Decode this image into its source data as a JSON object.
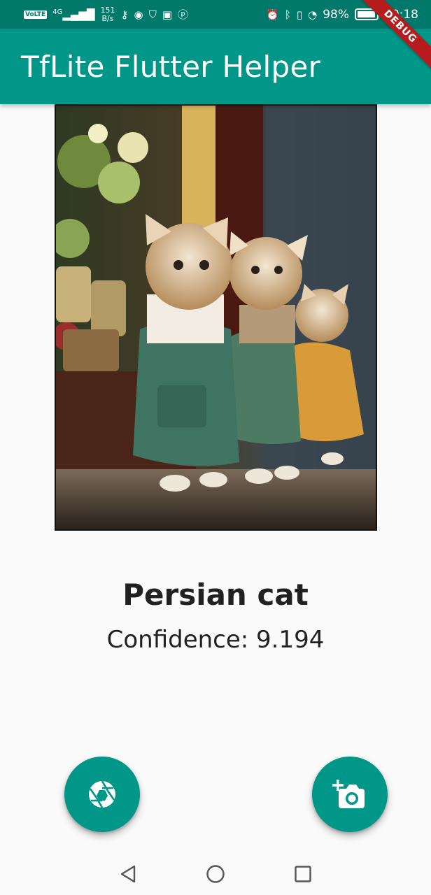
{
  "status_bar": {
    "volte": "VoLTE",
    "network": "4G",
    "speed_value": "151",
    "speed_unit": "B/s",
    "battery_percent": "98%",
    "battery_level": 0.98,
    "time": "20:18"
  },
  "app_bar": {
    "title": "TfLite Flutter Helper"
  },
  "debug_banner": {
    "label": "DEBUG"
  },
  "result": {
    "label": "Persian cat",
    "confidence": "Confidence: 9.194"
  },
  "colors": {
    "primary": "#009688",
    "status_bar": "#00796b",
    "debug": "#b71c1c"
  },
  "icons": {
    "fab_left": "camera-shutter-icon",
    "fab_right": "add-a-photo-icon"
  }
}
